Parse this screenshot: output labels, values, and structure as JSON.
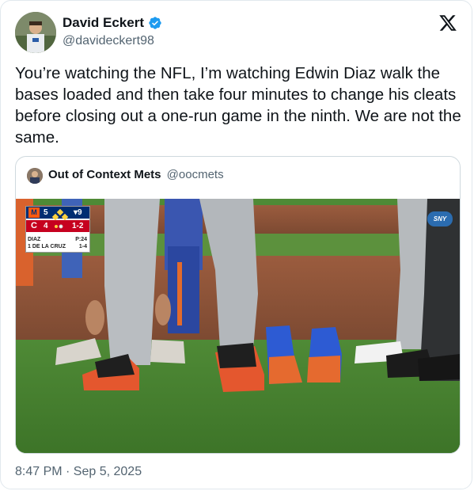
{
  "tweet": {
    "author_name": "David Eckert",
    "author_handle": "@davideckert98",
    "text": "You’re watching the NFL, I’m watching Edwin Diaz walk the bases loaded and then take four minutes to change his cleats before closing out a one-run game in the ninth. We are not the same.",
    "timestamp": "8:47 PM · Sep 5, 2025"
  },
  "quoted": {
    "author_name": "Out of Context Mets",
    "author_handle": "@oocmets"
  },
  "scorebug": {
    "team1_score": "5",
    "team2_score": "4",
    "inning": "▾9",
    "count": "1-2",
    "pitcher": "DIAZ",
    "pitch_count": "P:24",
    "batter": "1 DE LA CRUZ",
    "batter_line": "1-4",
    "network": "SNY"
  },
  "colors": {
    "verified": "#1d9bf0",
    "mets_blue": "#002d72",
    "mets_orange": "#ff5910",
    "reds_red": "#c6011f"
  }
}
